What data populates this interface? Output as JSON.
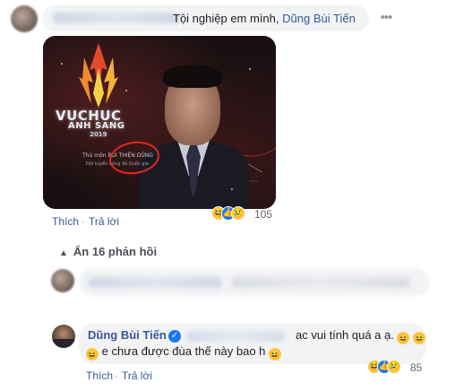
{
  "comment1": {
    "text": "Tội nghiệp em mình,",
    "mention": "Dũng Bùi Tiến",
    "photo": {
      "logo_line1": "VUCHUC",
      "logo_line2": "ANH SANG",
      "logo_year": "2019",
      "caption1": "Thủ môn BÙI THIỆN DŨNG",
      "caption2": "Đội tuyển bóng đá Quốc gia"
    },
    "actions": {
      "like": "Thích",
      "reply": "Trả lời"
    },
    "reaction_count": "105"
  },
  "replies_toggle": "Ẩn 16 phản hồi",
  "reply1": {
    "name": "Dũng Bùi Tiến",
    "text_line1": "ac vui tính quá a ạ.",
    "text_line2": "e chưa được đùa thế này bao h",
    "actions": {
      "like": "Thích",
      "reply": "Trả lời"
    },
    "reaction_count": "85"
  },
  "separator": "·",
  "more_glyph": "•••",
  "icons": {
    "haha": "😆",
    "like": "👍",
    "sad": "😢",
    "verified": "✓",
    "collapse": "▲"
  },
  "colors": {
    "link": "#385898",
    "bubble": "#f2f3f5",
    "like_blue": "#1877f2",
    "circle_red": "#e0281f"
  }
}
